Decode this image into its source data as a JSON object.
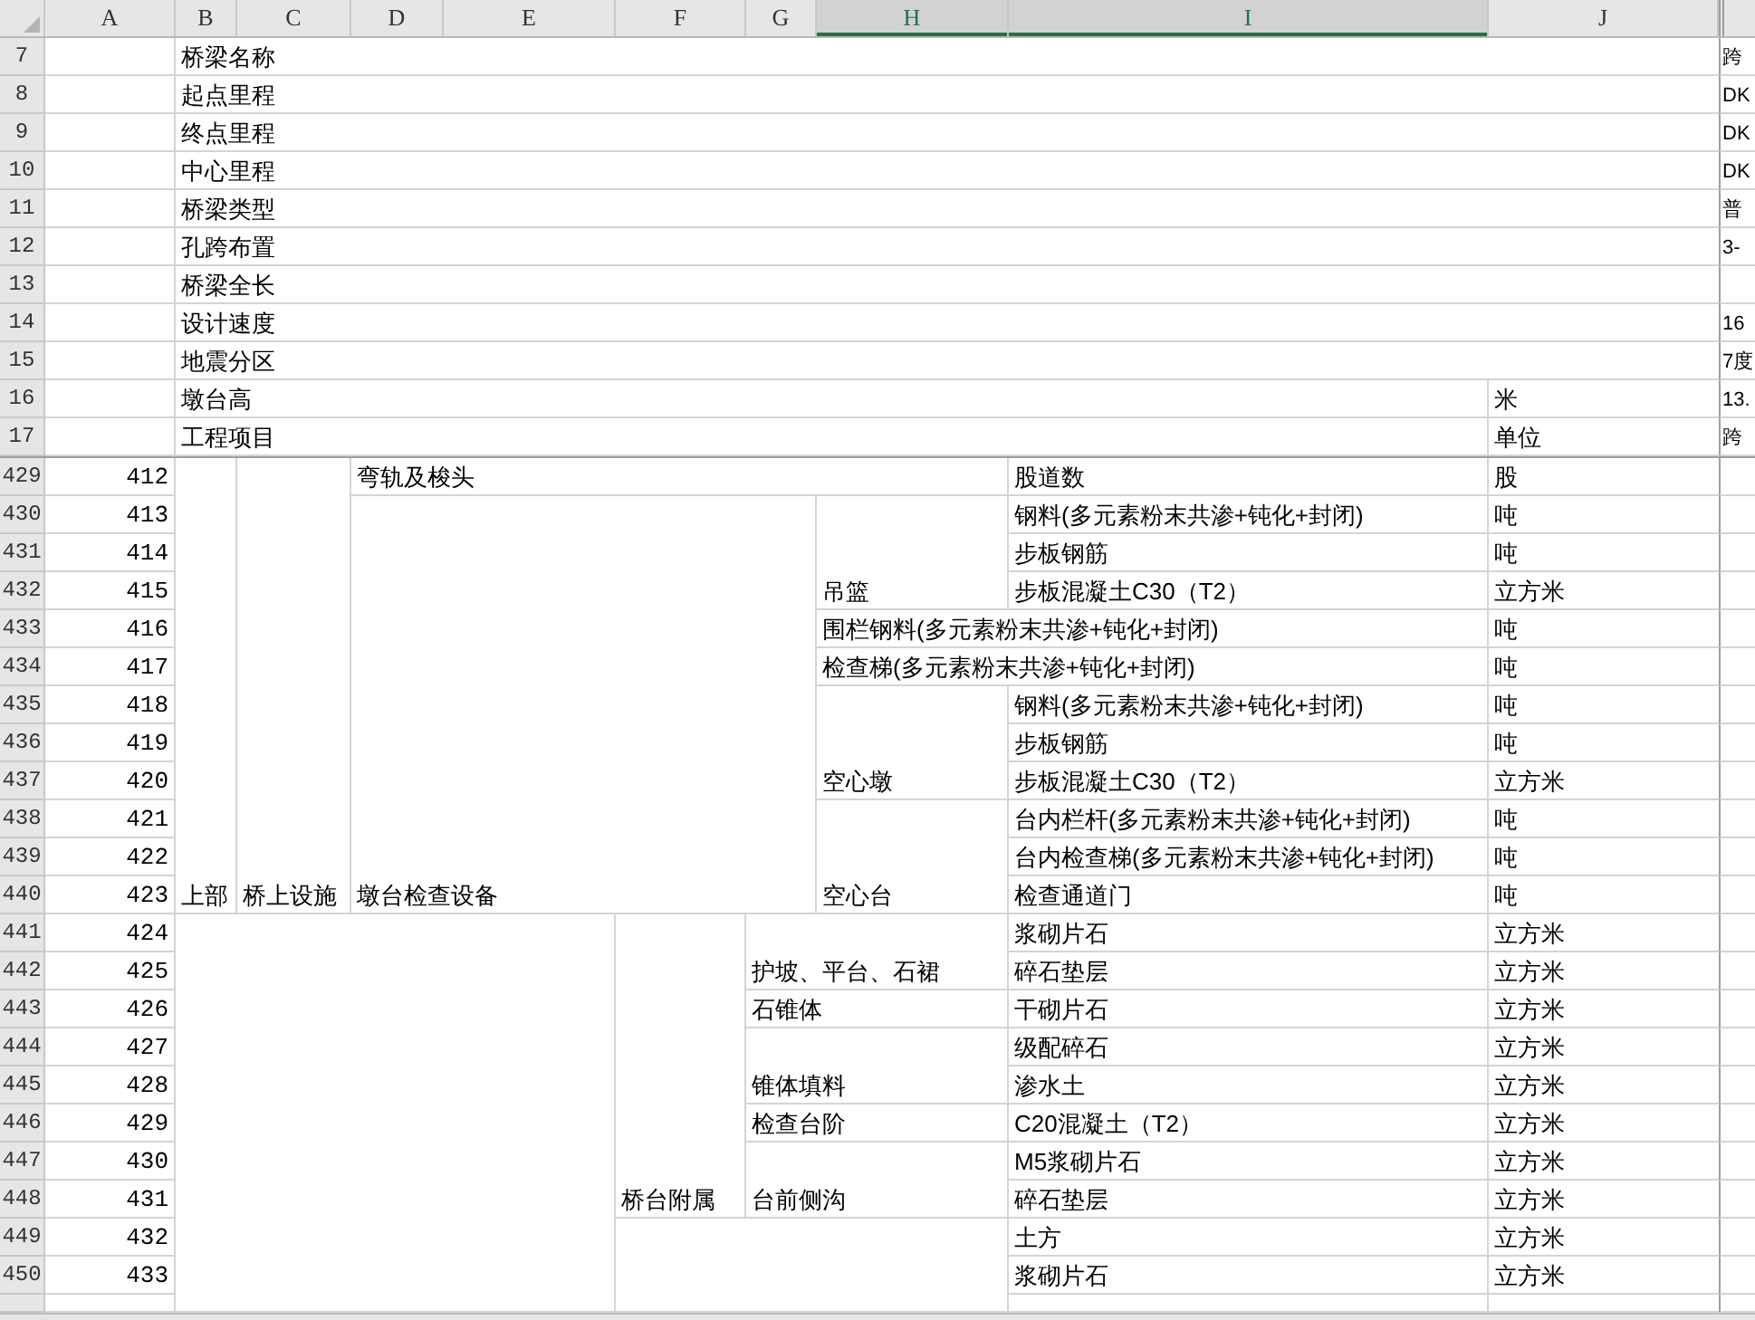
{
  "columns": [
    {
      "label": "A",
      "selected": false
    },
    {
      "label": "B",
      "selected": false
    },
    {
      "label": "C",
      "selected": false
    },
    {
      "label": "D",
      "selected": false
    },
    {
      "label": "E",
      "selected": false
    },
    {
      "label": "F",
      "selected": false
    },
    {
      "label": "G",
      "selected": false
    },
    {
      "label": "H",
      "selected": true
    },
    {
      "label": "I",
      "selected": true
    },
    {
      "label": "J",
      "selected": false
    }
  ],
  "info_rows": [
    {
      "row": "7",
      "label": "桥梁名称",
      "value": "跨"
    },
    {
      "row": "8",
      "label": "起点里程",
      "value": "DK"
    },
    {
      "row": "9",
      "label": "终点里程",
      "value": "DK"
    },
    {
      "row": "10",
      "label": "中心里程",
      "value": "DK"
    },
    {
      "row": "11",
      "label": "桥梁类型",
      "value": "普"
    },
    {
      "row": "12",
      "label": "孔跨布置",
      "value": "3-"
    },
    {
      "row": "13",
      "label": "桥梁全长"
    },
    {
      "row": "14",
      "label": "设计速度",
      "value": "16"
    },
    {
      "row": "15",
      "label": "地震分区",
      "value": "7度"
    },
    {
      "row": "16",
      "label": "墩台高",
      "unit": "米",
      "value": "13."
    },
    {
      "row": "17",
      "label": "工程项目",
      "unit": "单位",
      "value": "跨"
    }
  ],
  "merged_cells": [
    "上部",
    "桥上设施",
    "弯轨及梭头",
    "墩台检查设备",
    "吊篮",
    "围栏钢料(多元素粉末共渗+钝化+封闭)",
    "检查梯(多元素粉末共渗+钝化+封闭)",
    "空心墩",
    "空心台",
    "桥台附属",
    "护坡、平台、石裙",
    "石锥体",
    "锥体填料",
    "检查台阶",
    "台前侧沟"
  ],
  "item_rows": [
    {
      "row": "429",
      "no": "412",
      "material": "股道数",
      "unit": "股"
    },
    {
      "row": "430",
      "no": "413",
      "material": "钢料(多元素粉末共渗+钝化+封闭)",
      "unit": "吨"
    },
    {
      "row": "431",
      "no": "414",
      "material": "步板钢筋",
      "unit": "吨"
    },
    {
      "row": "432",
      "no": "415",
      "material": "步板混凝土C30（T2）",
      "unit": "立方米"
    },
    {
      "row": "433",
      "no": "416",
      "unit": "吨"
    },
    {
      "row": "434",
      "no": "417",
      "unit": "吨"
    },
    {
      "row": "435",
      "no": "418",
      "material": "钢料(多元素粉末共渗+钝化+封闭)",
      "unit": "吨"
    },
    {
      "row": "436",
      "no": "419",
      "material": "步板钢筋",
      "unit": "吨"
    },
    {
      "row": "437",
      "no": "420",
      "material": "步板混凝土C30（T2）",
      "unit": "立方米"
    },
    {
      "row": "438",
      "no": "421",
      "material": "台内栏杆(多元素粉末共渗+钝化+封闭)",
      "unit": "吨"
    },
    {
      "row": "439",
      "no": "422",
      "material": "台内检查梯(多元素粉末共渗+钝化+封闭)",
      "unit": "吨"
    },
    {
      "row": "440",
      "no": "423",
      "material": "检查通道门",
      "unit": "吨"
    },
    {
      "row": "441",
      "no": "424",
      "material": "浆砌片石",
      "unit": "立方米"
    },
    {
      "row": "442",
      "no": "425",
      "material": "碎石垫层",
      "unit": "立方米"
    },
    {
      "row": "443",
      "no": "426",
      "material": "干砌片石",
      "unit": "立方米"
    },
    {
      "row": "444",
      "no": "427",
      "material": "级配碎石",
      "unit": "立方米"
    },
    {
      "row": "445",
      "no": "428",
      "material": "渗水土",
      "unit": "立方米"
    },
    {
      "row": "446",
      "no": "429",
      "material": "C20混凝土（T2）",
      "unit": "立方米"
    },
    {
      "row": "447",
      "no": "430",
      "material": "M5浆砌片石",
      "unit": "立方米"
    },
    {
      "row": "448",
      "no": "431",
      "material": "碎石垫层",
      "unit": "立方米"
    },
    {
      "row": "449",
      "no": "432",
      "material": "土方",
      "unit": "立方米"
    },
    {
      "row": "450",
      "no": "433",
      "material": "浆砌片石",
      "unit": "立方米"
    }
  ]
}
